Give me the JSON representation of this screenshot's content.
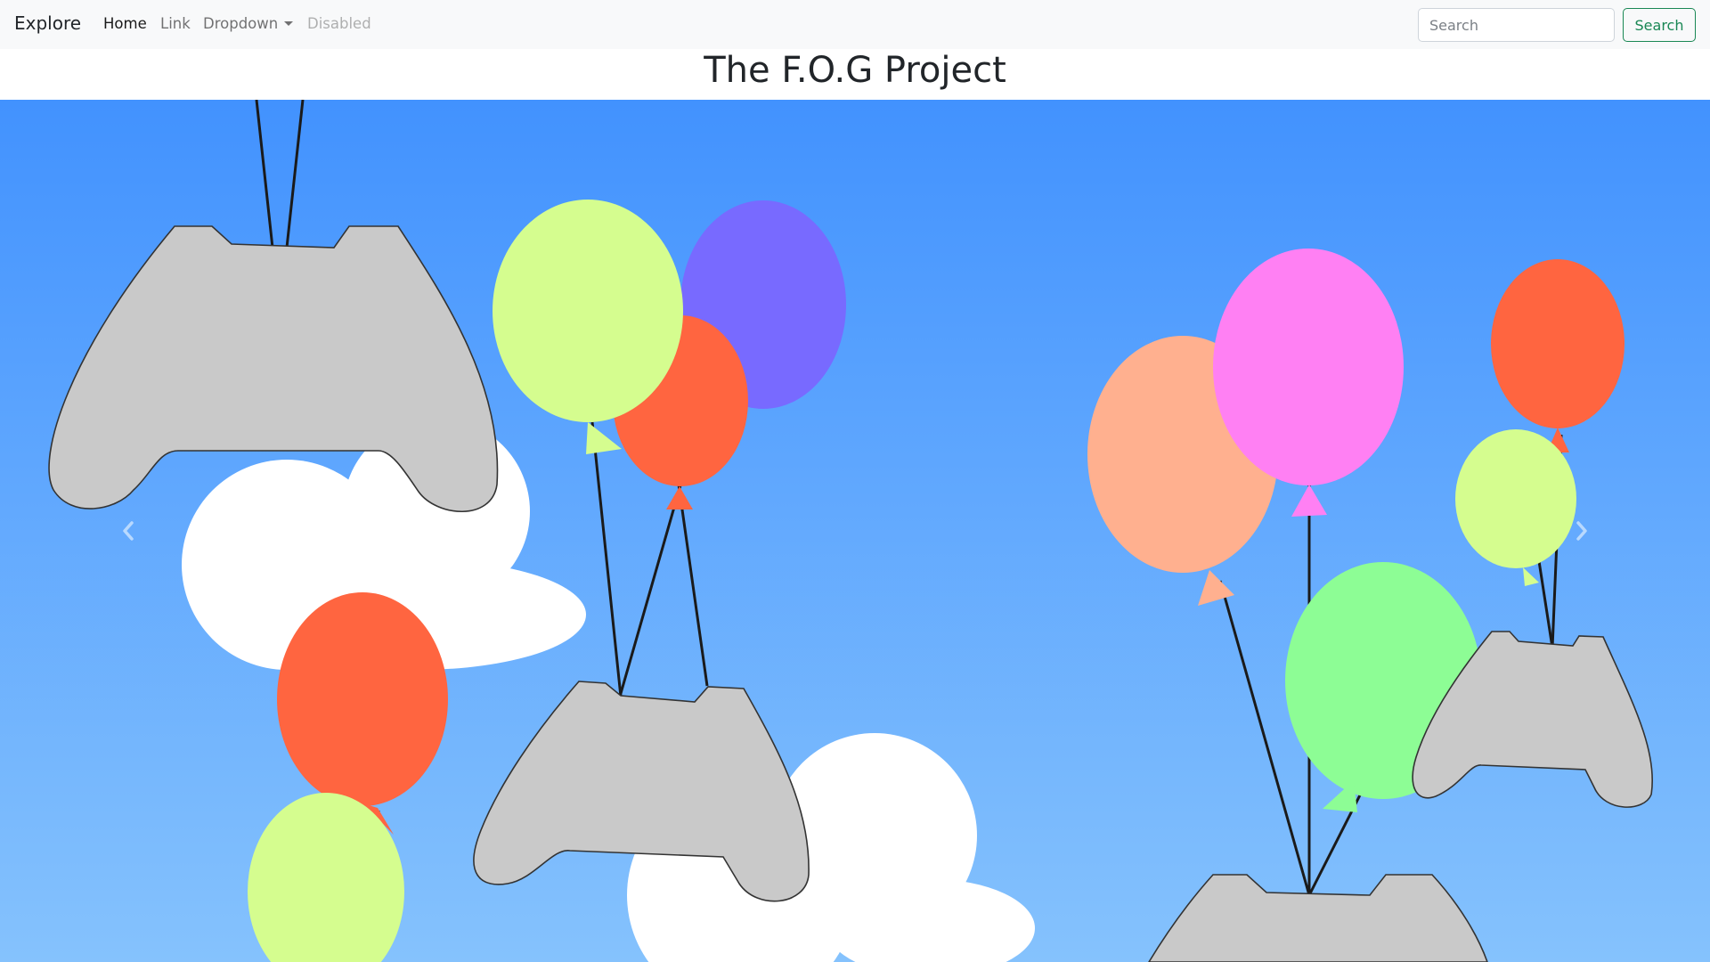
{
  "navbar": {
    "brand": "Explore",
    "links": {
      "home": "Home",
      "link": "Link",
      "dropdown": "Dropdown",
      "disabled": "Disabled"
    },
    "search": {
      "placeholder": "Search",
      "button": "Search"
    }
  },
  "page": {
    "title": "The F.O.G Project"
  },
  "carousel": {
    "prev_icon": "chevron-left-icon",
    "next_icon": "chevron-right-icon"
  },
  "colors": {
    "sky_top": "#4292fe",
    "sky_bottom": "#85c2fd",
    "controller": "#c9c9c9",
    "balloon_lime": "#d5fd8f",
    "balloon_purple": "#786aff",
    "balloon_red": "#ff6540",
    "balloon_peach": "#ffb08f",
    "balloon_pink": "#ff80f3",
    "balloon_green": "#8dfd95",
    "search_accent": "#198754"
  }
}
